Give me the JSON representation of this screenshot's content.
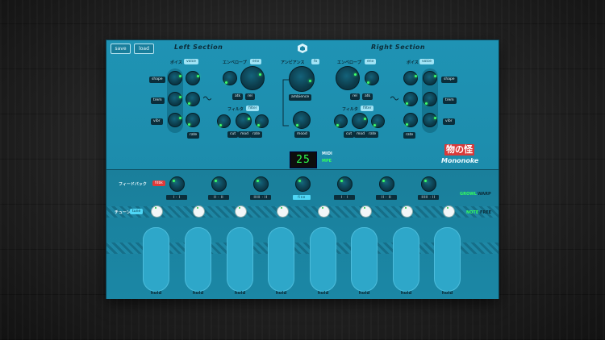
{
  "toolbar": {
    "save": "save",
    "load": "load"
  },
  "sections": {
    "left": "Left Section",
    "right": "Right Section"
  },
  "voice_label": "ボイス",
  "voice_tag": "voice",
  "envelope_label": "エンベロープ",
  "env_tag": "env",
  "ambience_jp": "アンビアンス",
  "fx_tag": "fx",
  "filter_label": "フィルタ",
  "filter_tag": "filter",
  "left_voice_params": [
    "shape",
    "trem",
    "vibr"
  ],
  "right_voice_params": [
    "shape",
    "trem",
    "vibr"
  ],
  "rate": "rate",
  "env_params": {
    "atk": "atk",
    "rel": "rel"
  },
  "filter_params": {
    "cut": "cut",
    "mod": "mod",
    "rate": "rate"
  },
  "center": {
    "ambience": "ambience",
    "mood": "mood"
  },
  "lcd": {
    "value": "25",
    "midi": "MIDI",
    "mpe": "MPE"
  },
  "logo": {
    "kanji": "物の怪",
    "name": "Mononoke"
  },
  "feedback": {
    "label": "フィードバック",
    "tag": "fdbk"
  },
  "tune": {
    "label": "チューン",
    "tag": "tune"
  },
  "step_labels": [
    "I · I",
    "II · II",
    "IIIII · II",
    "fine",
    "I · I",
    "II · II",
    "IIIII · II"
  ],
  "growl_warp": {
    "growl": "GROWL",
    "warp": "WARP"
  },
  "note_free": {
    "note": "NOTE",
    "free": "FREE"
  },
  "pads": [
    "hold",
    "hold",
    "hold",
    "hold",
    "hold",
    "hold",
    "hold",
    "hold"
  ],
  "colors": {
    "panel": "#1f93b4",
    "led": "#3cff6a",
    "accent": "#e03a3a"
  }
}
